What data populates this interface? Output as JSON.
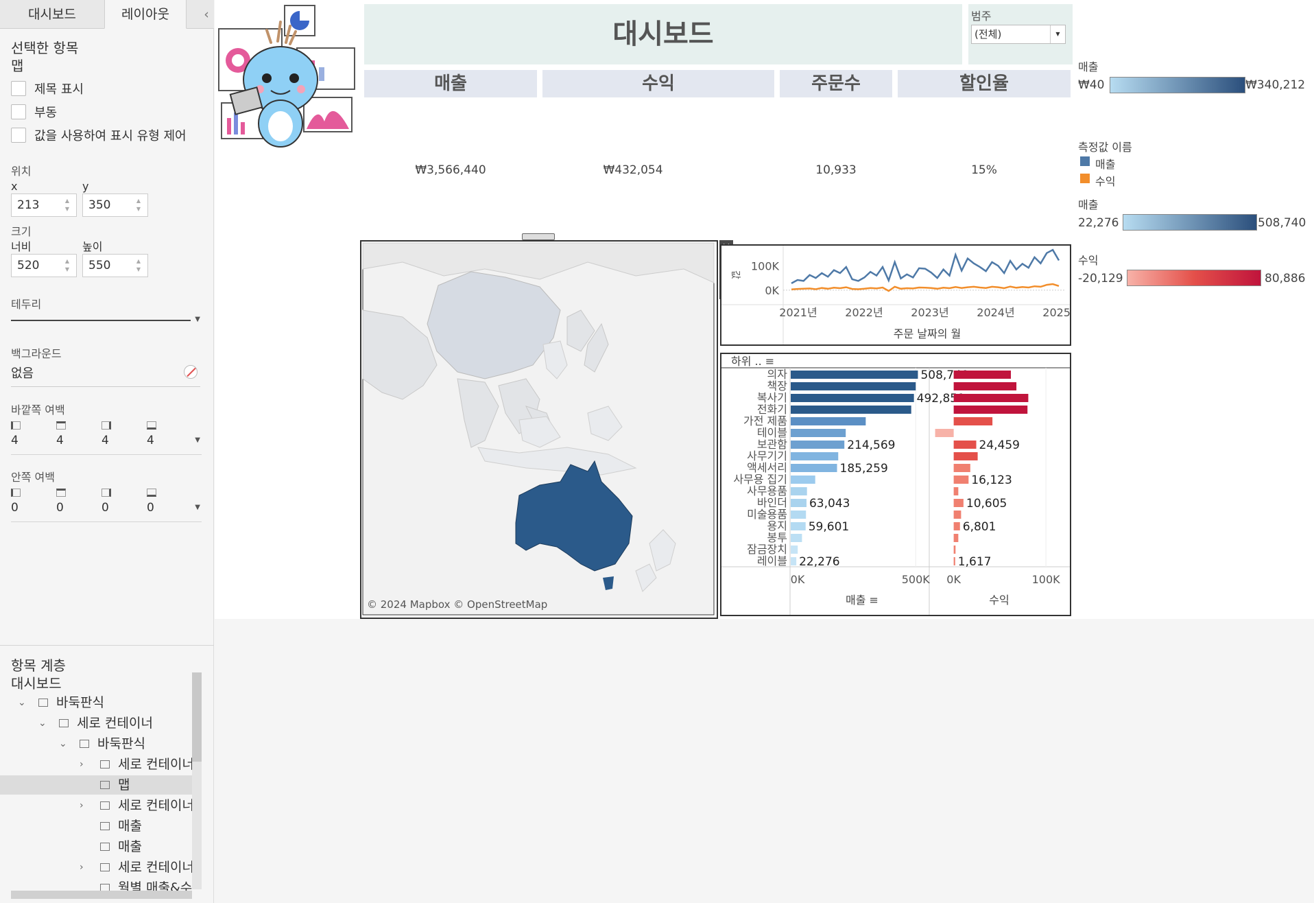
{
  "sidebar": {
    "tabs": [
      "대시보드",
      "레이아웃"
    ],
    "collapse": "‹",
    "selected_heading": "선택한 항목",
    "selected_name": "맵",
    "checkboxes": [
      "제목 표시",
      "부동",
      "값을 사용하여 표시 유형 제어"
    ],
    "position_label": "위치",
    "x_label": "x",
    "x_value": "213",
    "y_label": "y",
    "y_value": "350",
    "size_label": "크기",
    "width_label": "너비",
    "width_value": "520",
    "height_label": "높이",
    "height_value": "550",
    "border_label": "테두리",
    "background_label": "백그라운드",
    "background_value": "없음",
    "outer_padding_label": "바깥쪽 여백",
    "outer_padding": [
      "4",
      "4",
      "4",
      "4"
    ],
    "inner_padding_label": "안쪽 여백",
    "inner_padding": [
      "0",
      "0",
      "0",
      "0"
    ],
    "hierarchy_label": "항목 계층",
    "hierarchy_root": "대시보드",
    "tree": [
      {
        "label": "바둑판식",
        "icon": "tiled-icon",
        "arrow": "⌄"
      },
      {
        "label": "세로 컨테이너",
        "icon": "vertical-container-icon",
        "arrow": "⌄"
      },
      {
        "label": "바둑판식",
        "icon": "tiled-icon",
        "arrow": "⌄"
      },
      {
        "label": "세로 컨테이너",
        "icon": "vertical-container-icon",
        "arrow": "›"
      },
      {
        "label": "맵",
        "icon": "sheet-icon",
        "arrow": ""
      },
      {
        "label": "세로 컨테이너",
        "icon": "vertical-container-icon",
        "arrow": "›"
      },
      {
        "label": "매출",
        "icon": "legend-icon",
        "arrow": ""
      },
      {
        "label": "매출",
        "icon": "legend-icon",
        "arrow": ""
      },
      {
        "label": "세로 컨테이너",
        "icon": "vertical-container-icon",
        "arrow": "›"
      },
      {
        "label": "월별 매출&수",
        "icon": "sheet-icon",
        "arrow": ""
      }
    ]
  },
  "dashboard": {
    "title": "대시보드",
    "filter_label": "범주",
    "filter_value": "(전체)",
    "kpis": [
      {
        "label": "매출",
        "value": "₩3,566,440"
      },
      {
        "label": "수익",
        "value": "₩432,054"
      },
      {
        "label": "주문수",
        "value": "10,933"
      },
      {
        "label": "할인율",
        "value": "15%"
      }
    ],
    "map_attribution": "© 2024 Mapbox © OpenStreetMap",
    "colors": {
      "blue_dark": "#2b5a8a",
      "blue_light": "#a9d3ee",
      "orange": "#f28e2b",
      "red_dark": "#c0143c",
      "red_light": "#f7b2a8",
      "header_bg": "#e3e7f0",
      "title_bg": "#e6f0ee"
    }
  },
  "legends": {
    "sales_map": {
      "title": "매출",
      "min": "₩40",
      "max": "₩340,212"
    },
    "measure_names": {
      "title": "측정값 이름",
      "items": [
        {
          "name": "매출",
          "color": "#4e79a7"
        },
        {
          "name": "수익",
          "color": "#f28e2b"
        }
      ]
    },
    "sales_bar": {
      "title": "매출",
      "min": "22,276",
      "max": "508,740"
    },
    "profit_bar": {
      "title": "수익",
      "min": "-20,129",
      "max": "80,886"
    }
  },
  "chart_data": [
    {
      "type": "line",
      "xlabel": "주문 날짜의 월",
      "ylabel": "값",
      "x_ticks": [
        "2021년",
        "2022년",
        "2023년",
        "2024년",
        "2025년"
      ],
      "y_ticks": [
        "100K",
        "0K"
      ],
      "ylim": [
        -20000,
        160000
      ],
      "series": [
        {
          "name": "매출",
          "color": "#4e79a7",
          "values": [
            28000,
            42000,
            38000,
            62000,
            50000,
            70000,
            55000,
            82000,
            70000,
            95000,
            45000,
            38000,
            52000,
            75000,
            60000,
            95000,
            40000,
            115000,
            48000,
            65000,
            52000,
            90000,
            88000,
            72000,
            50000,
            85000,
            60000,
            145000,
            80000,
            130000,
            110000,
            95000,
            78000,
            115000,
            100000,
            70000,
            120000,
            85000,
            108000,
            92000,
            135000,
            110000,
            152000,
            165000,
            122000
          ]
        },
        {
          "name": "수익",
          "color": "#f28e2b",
          "values": [
            3000,
            5000,
            6000,
            7000,
            4000,
            9000,
            6000,
            10000,
            8000,
            12000,
            5000,
            4000,
            6000,
            9000,
            7000,
            11000,
            -3000,
            14000,
            6000,
            8000,
            7000,
            11000,
            10000,
            9000,
            6000,
            10000,
            8000,
            13000,
            9000,
            12000,
            14000,
            11000,
            9000,
            14000,
            12000,
            8000,
            15000,
            10000,
            13000,
            11000,
            16000,
            14000,
            22000,
            25000,
            17000
          ]
        }
      ]
    },
    {
      "type": "bar",
      "header": "하위 ..",
      "categories": [
        "의자",
        "책장",
        "복사기",
        "전화기",
        "가전 제품",
        "테이블",
        "보관함",
        "사무기기",
        "액세서리",
        "사무용 집기",
        "사무용품",
        "바인더",
        "미술용품",
        "용지",
        "봉투",
        "잠금장치",
        "레이블"
      ],
      "series": [
        {
          "name": "매출",
          "values": [
            508740,
            500000,
            492851,
            482000,
            300000,
            220000,
            214569,
            190000,
            185259,
            98000,
            65000,
            63043,
            61000,
            59601,
            45000,
            28000,
            22276
          ],
          "labels": [
            "508,740",
            "",
            "492,851",
            "",
            "",
            "",
            "214,569",
            "",
            "185,259",
            "",
            "",
            "63,043",
            "",
            "59,601",
            "",
            "",
            "22,276"
          ]
        },
        {
          "name": "수익",
          "values": [
            62000,
            68000,
            80886,
            80000,
            42000,
            -20129,
            24459,
            26000,
            18000,
            16123,
            5000,
            10605,
            8000,
            6801,
            5000,
            2000,
            1617
          ],
          "labels": [
            "",
            "",
            "",
            "",
            "",
            "",
            "24,459",
            "",
            "",
            "16,123",
            "",
            "10,605",
            "",
            "6,801",
            "",
            "",
            "1,617"
          ]
        }
      ],
      "sales_axis": {
        "label": "매출",
        "ticks": [
          "0K",
          "500K"
        ],
        "max": 620000
      },
      "profit_axis": {
        "label": "수익",
        "ticks": [
          "0K",
          "100K"
        ],
        "min": -25000,
        "max": 120000
      }
    }
  ]
}
